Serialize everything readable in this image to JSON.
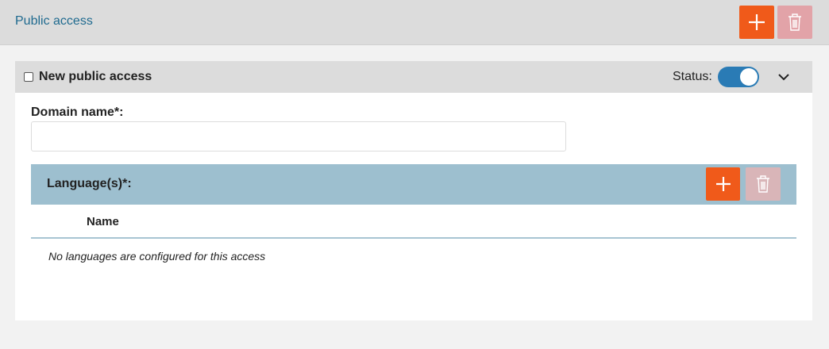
{
  "topbar": {
    "title": "Public access",
    "add_icon": "plus-icon",
    "delete_icon": "trash-icon"
  },
  "panel": {
    "title": "New public access",
    "status_label": "Status:",
    "status_on": true,
    "collapse_icon": "chevron-down-icon"
  },
  "domain_field": {
    "label": "Domain name*:",
    "value": "",
    "placeholder": ""
  },
  "languages": {
    "title": "Language(s)*:",
    "columns": [
      "Name"
    ],
    "empty_message": "No languages are configured for this access"
  },
  "colors": {
    "accent_orange": "#f05a1a",
    "toggle_blue": "#2a7bb5",
    "section_blue": "#9dbfcf",
    "link_blue": "#1f6a8f"
  }
}
